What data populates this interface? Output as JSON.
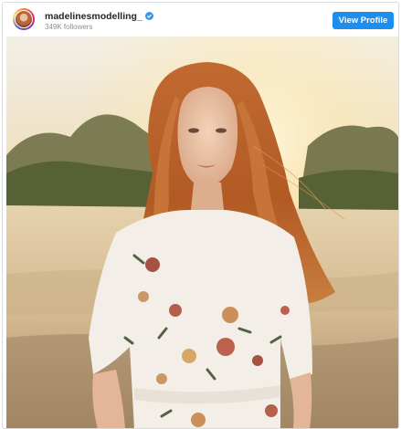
{
  "profile": {
    "username": "madelinesmodelling_",
    "followers": "349K followers",
    "view_profile_label": "View Profile"
  },
  "icons": {
    "verified": "verified-badge-icon",
    "avatar": "profile-avatar"
  },
  "colors": {
    "button": "#1d8dee",
    "verified": "#3897f0"
  }
}
